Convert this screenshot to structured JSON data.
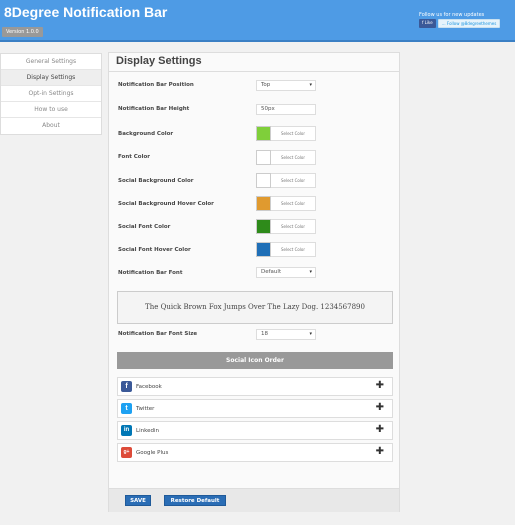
{
  "app": {
    "title": "8Degree Notification Bar",
    "version": "Version 1.0.0",
    "follow_text": "Follow us for new updates",
    "like_label": "f Like",
    "twitter_label": "… Follow @8degreethemes"
  },
  "sidebar": {
    "items": [
      {
        "label": "General Settings",
        "active": false
      },
      {
        "label": "Display Settings",
        "active": true
      },
      {
        "label": "Opt-in Settings",
        "active": false
      },
      {
        "label": "How to use",
        "active": false
      },
      {
        "label": "About",
        "active": false
      }
    ]
  },
  "panel": {
    "title": "Display Settings",
    "fields": {
      "position_label": "Notification Bar Position",
      "position_value": "Top",
      "height_label": "Notification Bar Height",
      "height_value": "50px",
      "bg_color_label": "Background Color",
      "bg_color": "#7fcf3a",
      "font_color_label": "Font Color",
      "font_color": "#ffffff",
      "social_bg_label": "Social Background Color",
      "social_bg": "#ffffff",
      "social_bg_hover_label": "Social Background Hover Color",
      "social_bg_hover": "#e09a2f",
      "social_font_label": "Social Font Color",
      "social_font": "#2e8b1a",
      "social_font_hover_label": "Social Font Hover Color",
      "social_font_hover": "#1f6fb7",
      "font_label": "Notification Bar Font",
      "font_value": "Default",
      "font_size_label": "Notification Bar Font Size",
      "font_size_value": "18"
    },
    "select_color_label": "Select Color",
    "preview_text": "The Quick Brown Fox Jumps Over The Lazy Dog. 1234567890",
    "social_order_title": "Social Icon Order",
    "social_items": [
      {
        "label": "Facebook",
        "icon": "facebook-icon",
        "icon_glyph": "f",
        "color": "#3b5998"
      },
      {
        "label": "Twitter",
        "icon": "twitter-icon",
        "icon_glyph": "t",
        "color": "#1da1f2"
      },
      {
        "label": "Linkedin",
        "icon": "linkedin-icon",
        "icon_glyph": "in",
        "color": "#0077b5"
      },
      {
        "label": "Google Plus",
        "icon": "google-plus-icon",
        "icon_glyph": "g+",
        "color": "#dd4b39"
      }
    ],
    "save_label": "SAVE",
    "restore_label": "Restore Default"
  }
}
